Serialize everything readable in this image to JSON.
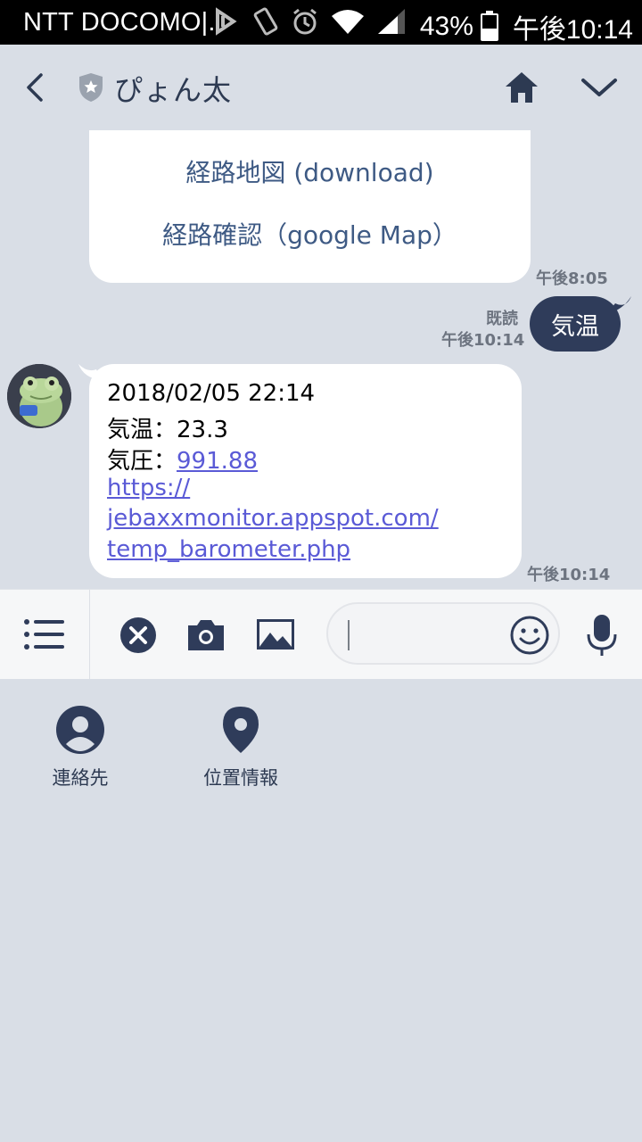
{
  "status_bar": {
    "carrier": "NTT DOCOMO|.",
    "battery": "43%",
    "time": "午後10:14",
    "icons": [
      "nfc-icon",
      "vibrate-icon",
      "alarm-icon",
      "wifi-icon",
      "signal-icon",
      "battery-icon"
    ]
  },
  "header": {
    "title": "ぴょん太",
    "icons": [
      "back-icon",
      "shield-icon",
      "home-icon",
      "chevron-down-icon"
    ]
  },
  "messages": {
    "route_card": {
      "link1": "経路地図 (download)",
      "link2": "経路確認（google Map）",
      "time": "午後8:05"
    },
    "sent": {
      "text": "気温",
      "read": "既読",
      "time": "午後10:14"
    },
    "received": {
      "line1": "2018/02/05 22:14",
      "line2": "気温：23.3",
      "line3_label": "気圧：",
      "line3_value": "991.88",
      "url_line1": "https://",
      "url_line2": "jebaxxmonitor.appspot.com/",
      "url_line3": "temp_barometer.php",
      "time": "午後10:14"
    }
  },
  "input_bar": {
    "placeholder": "",
    "icons": [
      "menu-icon",
      "close-icon",
      "camera-icon",
      "image-icon",
      "smiley-icon",
      "mic-icon"
    ]
  },
  "attach_menu": {
    "contact_label": "連絡先",
    "location_label": "位置情報"
  },
  "colors": {
    "background": "#d9dee6",
    "accent": "#2f3c5a",
    "link": "#5a5ad6"
  }
}
